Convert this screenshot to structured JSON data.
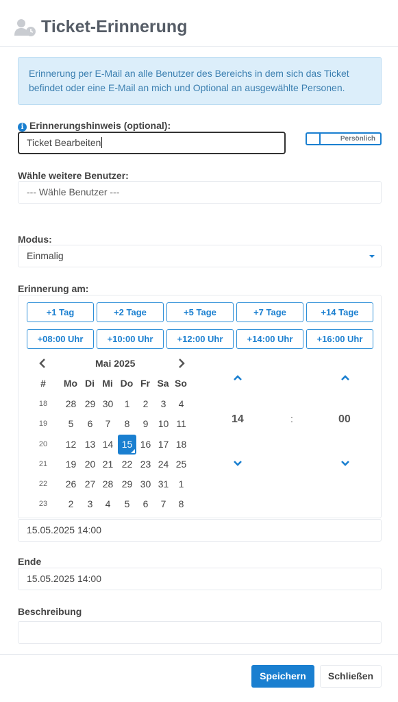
{
  "header": {
    "title": "Ticket-Erinnerung",
    "icon": "user-clock-icon"
  },
  "info": {
    "text": "Erinnerung per E-Mail an alle Benutzer des Bereichs in dem sich das Ticket befindet oder eine E-Mail an mich und Optional an ausgewählte Personen."
  },
  "hint": {
    "label": "Erinnerungshinweis (optional):",
    "value": "Ticket Bearbeiten",
    "toggle_label": "Persönlich"
  },
  "users": {
    "label": "Wähle weitere Benutzer:",
    "placeholder": "--- Wähle Benutzer ---"
  },
  "mode": {
    "label": "Modus:",
    "value": "Einmalig"
  },
  "reminder": {
    "label": "Erinnerung am:",
    "quick_days": [
      "+1 Tag",
      "+2 Tage",
      "+5 Tage",
      "+7 Tage",
      "+14 Tage"
    ],
    "quick_times": [
      "+08:00 Uhr",
      "+10:00 Uhr",
      "+12:00 Uhr",
      "+14:00 Uhr",
      "+16:00 Uhr"
    ],
    "calendar": {
      "month": "Mai 2025",
      "headers": [
        "#",
        "Mo",
        "Di",
        "Mi",
        "Do",
        "Fr",
        "Sa",
        "So"
      ],
      "weeks": [
        {
          "num": "18",
          "days": [
            "28",
            "29",
            "30",
            "1",
            "2",
            "3",
            "4"
          ]
        },
        {
          "num": "19",
          "days": [
            "5",
            "6",
            "7",
            "8",
            "9",
            "10",
            "11"
          ]
        },
        {
          "num": "20",
          "days": [
            "12",
            "13",
            "14",
            "15",
            "16",
            "17",
            "18"
          ]
        },
        {
          "num": "21",
          "days": [
            "19",
            "20",
            "21",
            "22",
            "23",
            "24",
            "25"
          ]
        },
        {
          "num": "22",
          "days": [
            "26",
            "27",
            "28",
            "29",
            "30",
            "31",
            "1"
          ]
        },
        {
          "num": "23",
          "days": [
            "2",
            "3",
            "4",
            "5",
            "6",
            "7",
            "8"
          ]
        }
      ],
      "selected_day": "15"
    },
    "time": {
      "hour": "14",
      "separator": ":",
      "minute": "00"
    },
    "value": "15.05.2025 14:00"
  },
  "end": {
    "label": "Ende",
    "value": "15.05.2025 14:00"
  },
  "description": {
    "label": "Beschreibung",
    "value": ""
  },
  "footer": {
    "save_label": "Speichern",
    "close_label": "Schließen"
  },
  "colors": {
    "accent": "#1a7fd0",
    "info_bg": "#dceefa",
    "info_text": "#3b7fb0"
  }
}
